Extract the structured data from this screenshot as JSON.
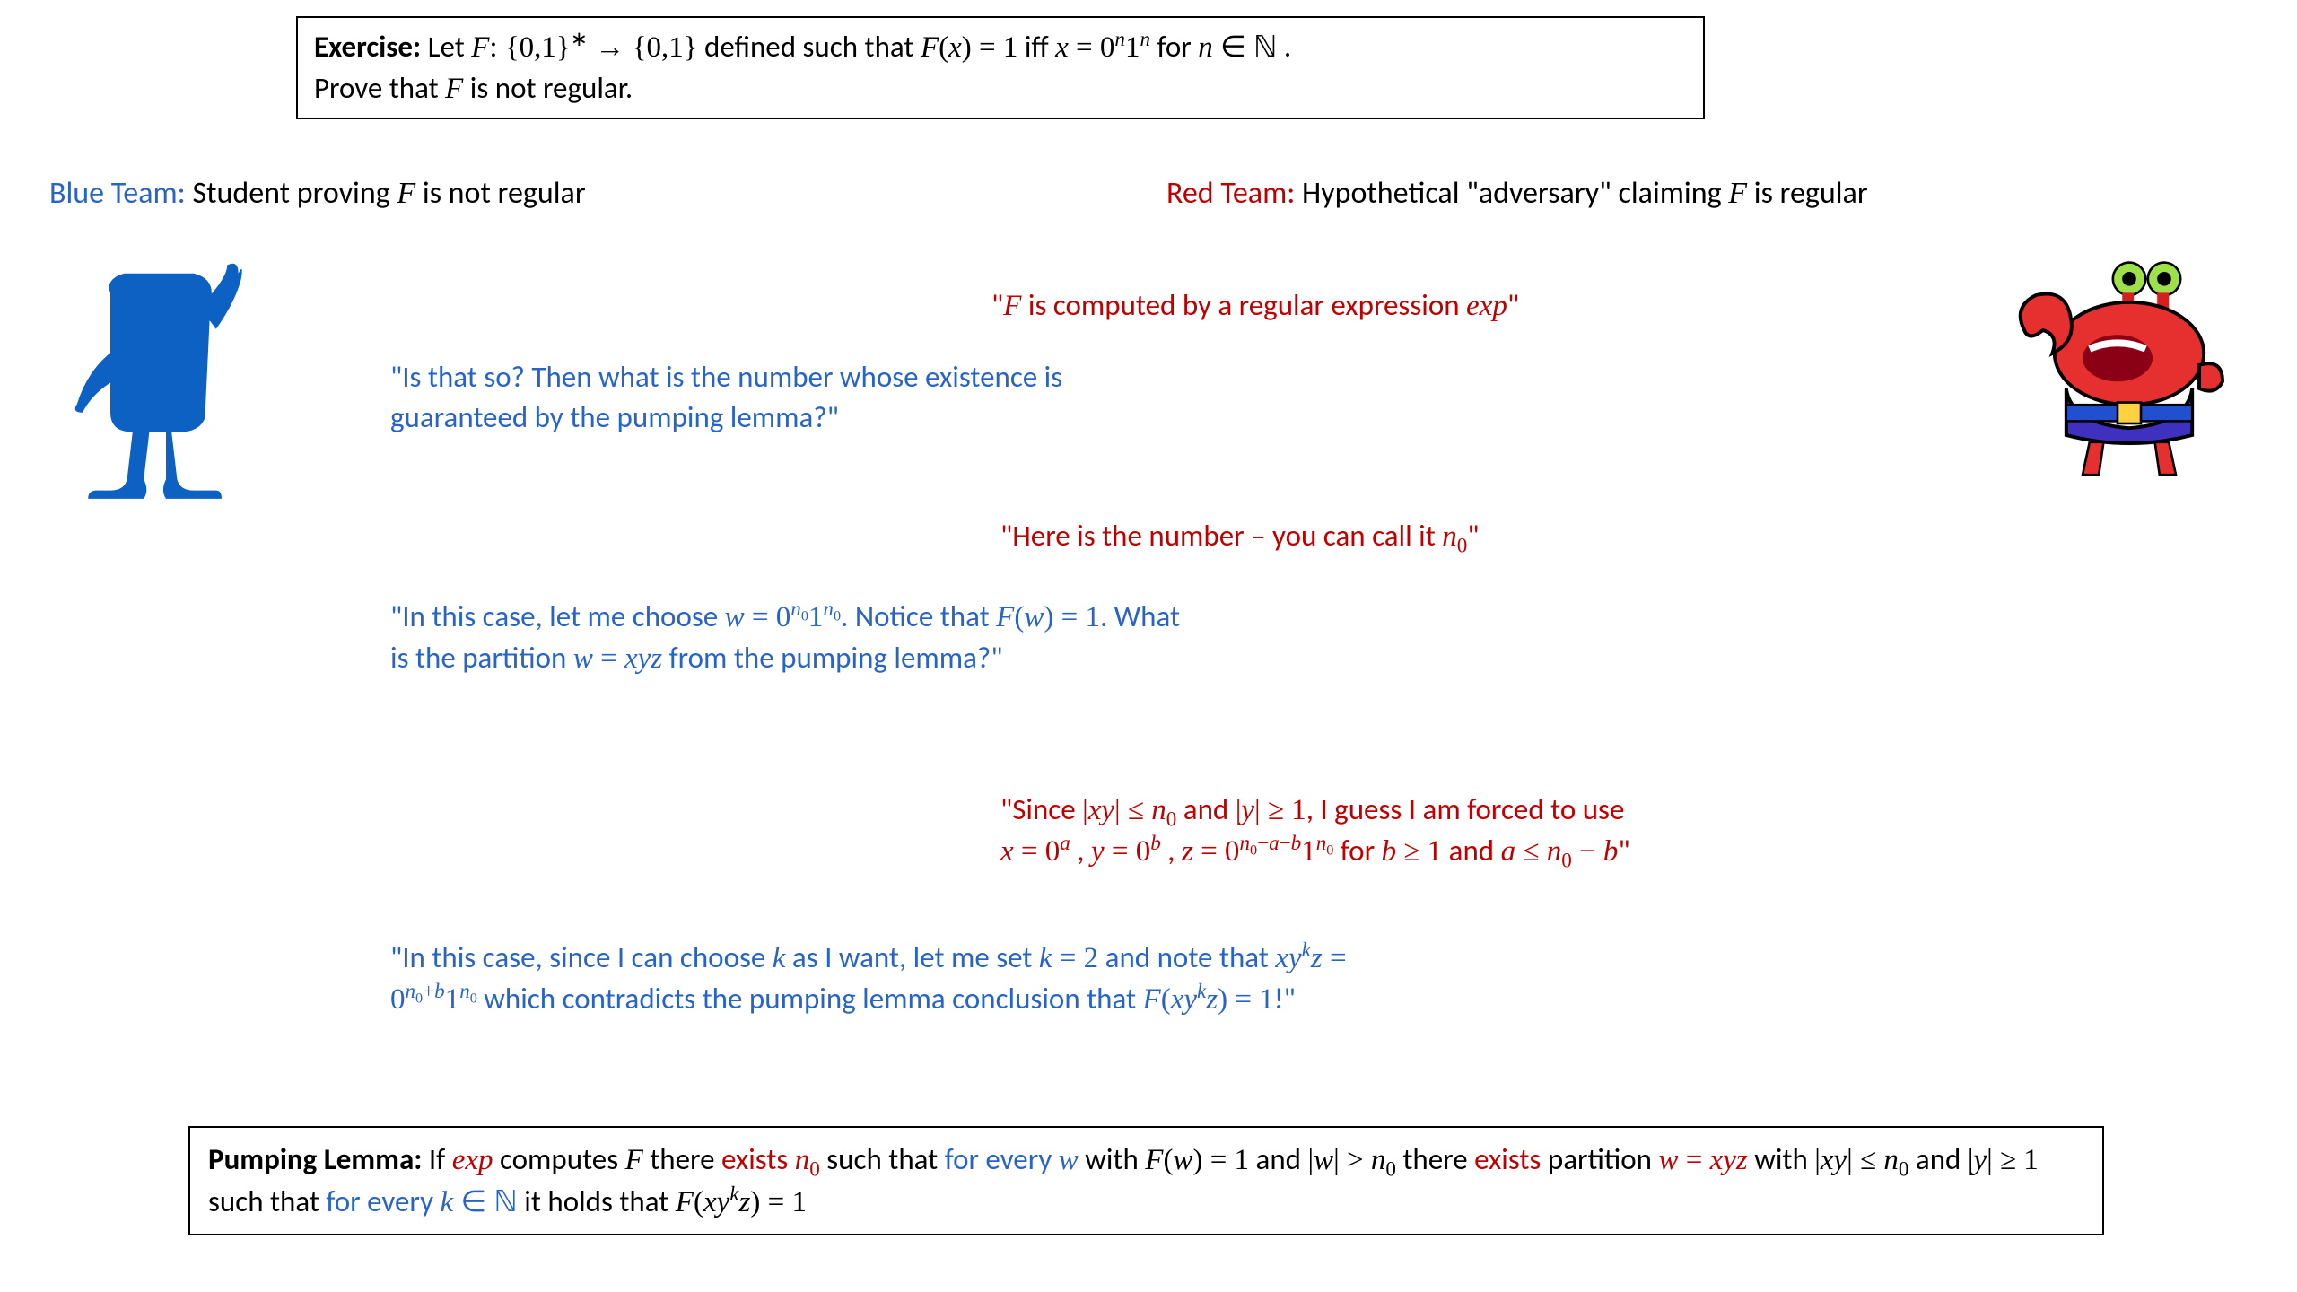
{
  "exercise": {
    "label": "Exercise:",
    "line1_a": " Let ",
    "line1_b": " defined such that ",
    "line1_c": " iff ",
    "line1_d": " for ",
    "line1_e": " .",
    "line2_a": "Prove that ",
    "line2_b": " is not regular."
  },
  "teams": {
    "blue_label": "Blue Team:",
    "blue_text": " Student proving ",
    "blue_suffix": " is not regular",
    "red_label": "Red Team:",
    "red_text": " Hypothetical \"adversary\" claiming  ",
    "red_suffix": " is regular"
  },
  "dialogue": {
    "red1_a": "\"",
    "red1_b": " is computed by a regular expression ",
    "red1_c": "\"",
    "blue1": "\"Is that so? Then what is the number whose existence is guaranteed by the pumping lemma?\"",
    "red2_a": "\"Here is the number – you can call it ",
    "red2_b": "\"",
    "blue2_a": "\"In this case, let me choose ",
    "blue2_b": ". Notice that ",
    "blue2_c": ". What is the partition ",
    "blue2_d": " from the pumping lemma?\"",
    "red3_a": "\"Since ",
    "red3_b": " and ",
    "red3_c": ", I guess I am forced to use",
    "red3_d": " , ",
    "red3_e": " , ",
    "red3_f": " for ",
    "red3_g": " and ",
    "red3_h": "\"",
    "blue3_a": "\"In this case, since I can choose  ",
    "blue3_b": " as I want, let me set ",
    "blue3_c": " and note that ",
    "blue3_d": "  which contradicts the pumping lemma conclusion that ",
    "blue3_e": "!\""
  },
  "lemma": {
    "label": "Pumping Lemma:",
    "t1": " If ",
    "t2": " computes ",
    "t3": " there ",
    "t4": "exists",
    "t5": " such that ",
    "t6": "for every",
    "t7": " with ",
    "t8": " and ",
    "t9": " there ",
    "t10": "exists",
    "t11": " partition ",
    "t12": " with ",
    "t13": " and ",
    "t14": " such that ",
    "t15": "for every",
    "t16": " it holds that "
  }
}
